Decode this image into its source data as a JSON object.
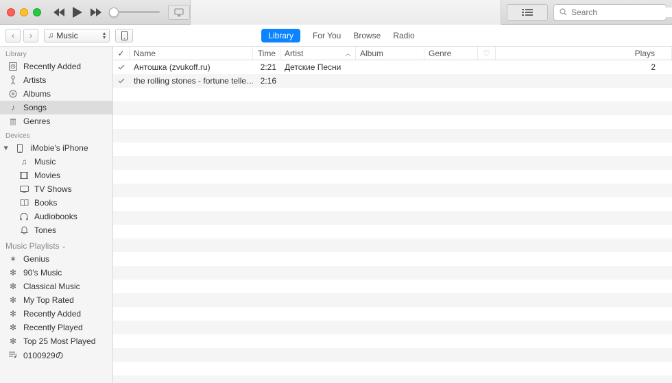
{
  "titlebar": {
    "search_placeholder": "Search"
  },
  "nav": {
    "back": "‹",
    "fwd": "›",
    "source": "Music",
    "tabs": [
      "Library",
      "For You",
      "Browse",
      "Radio"
    ],
    "active_tab": "Library"
  },
  "sidebar": {
    "library_header": "Library",
    "library": [
      {
        "icon": "clock",
        "label": "Recently Added"
      },
      {
        "icon": "mic",
        "label": "Artists"
      },
      {
        "icon": "album",
        "label": "Albums"
      },
      {
        "icon": "note",
        "label": "Songs"
      },
      {
        "icon": "genre",
        "label": "Genres"
      }
    ],
    "devices_header": "Devices",
    "device": {
      "label": "iMobie's iPhone"
    },
    "device_children": [
      {
        "icon": "note",
        "label": "Music"
      },
      {
        "icon": "movie",
        "label": "Movies"
      },
      {
        "icon": "tv",
        "label": "TV Shows"
      },
      {
        "icon": "book",
        "label": "Books"
      },
      {
        "icon": "audio",
        "label": "Audiobooks"
      },
      {
        "icon": "tone",
        "label": "Tones"
      }
    ],
    "playlists_header": "Music Playlists",
    "playlists": [
      {
        "icon": "gear",
        "label": "Genius"
      },
      {
        "icon": "gear",
        "label": "90's Music"
      },
      {
        "icon": "gear",
        "label": "Classical Music"
      },
      {
        "icon": "gear",
        "label": "My Top Rated"
      },
      {
        "icon": "gear",
        "label": "Recently Added"
      },
      {
        "icon": "gear",
        "label": "Recently Played"
      },
      {
        "icon": "gear",
        "label": "Top 25 Most Played"
      },
      {
        "icon": "list",
        "label": "0100929の"
      }
    ]
  },
  "columns": {
    "check": "✓",
    "name": "Name",
    "time": "Time",
    "artist": "Artist",
    "album": "Album",
    "genre": "Genre",
    "love": "♡",
    "plays": "Plays"
  },
  "songs": [
    {
      "checked": true,
      "name": "Антошка (zvukoff.ru)",
      "time": "2:21",
      "artist": "Детские Песни",
      "album": "",
      "genre": "",
      "plays": "2"
    },
    {
      "checked": true,
      "name": "the rolling stones - fortune telle…",
      "time": "2:16",
      "artist": "",
      "album": "",
      "genre": "",
      "plays": ""
    }
  ]
}
